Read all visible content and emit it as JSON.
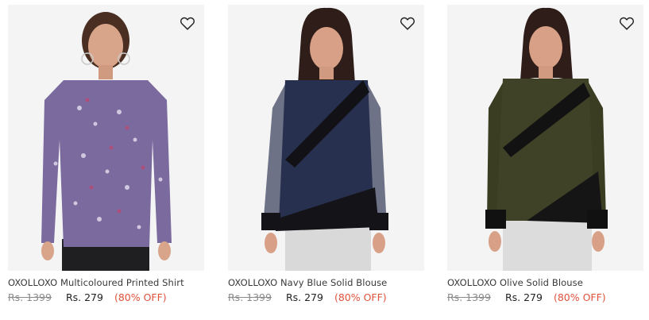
{
  "products": [
    {
      "title": "OXOLLOXO Multicoloured Printed Shirt",
      "mrp": "Rs. 1399",
      "price": "Rs. 279",
      "discount": "(80% OFF)",
      "colors": {
        "top": "#7a6a9e",
        "bottom": "#1f1f22",
        "skin": "#d9a58a",
        "hair": "#4a2e22"
      }
    },
    {
      "title": "OXOLLOXO Navy Blue Solid Blouse",
      "mrp": "Rs. 1399",
      "price": "Rs. 279",
      "discount": "(80% OFF)",
      "colors": {
        "top": "#27304f",
        "bottom": "#d9d9d9",
        "skin": "#d8a086",
        "hair": "#2e1d18"
      }
    },
    {
      "title": "OXOLLOXO Olive Solid Blouse",
      "mrp": "Rs. 1399",
      "price": "Rs. 279",
      "discount": "(80% OFF)",
      "colors": {
        "top": "#3f4226",
        "bottom": "#dcdcdc",
        "skin": "#d8a086",
        "hair": "#2e1d18"
      }
    }
  ],
  "icons": {
    "wishlist": "heart-outline-icon"
  },
  "theme": {
    "discount_color": "#e0533b",
    "mrp_color": "#8a8a8a"
  }
}
